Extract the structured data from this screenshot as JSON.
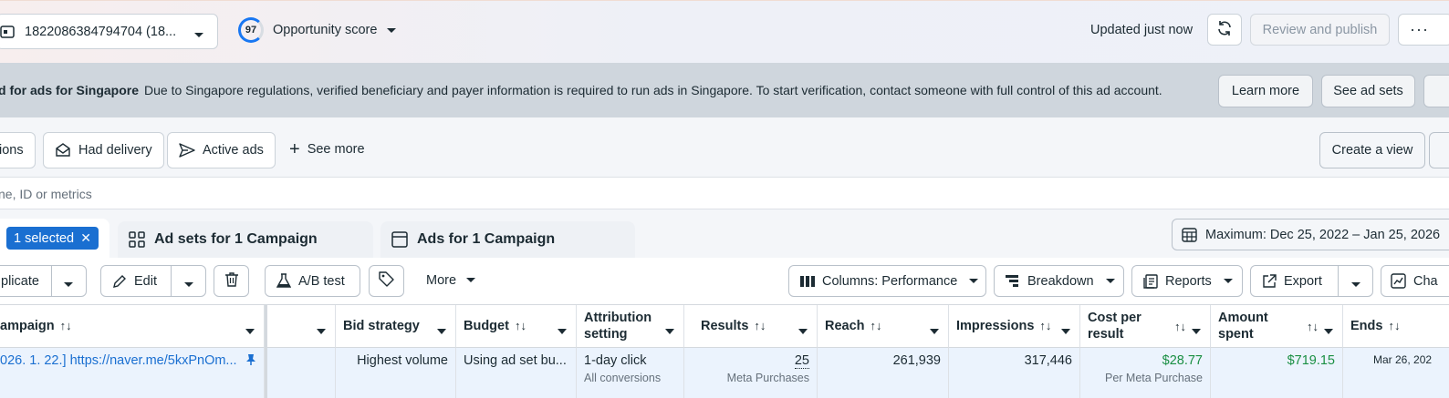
{
  "topbar": {
    "account_label": "1822086384794704 (18...",
    "opportunity_score": "97",
    "opportunity_label": "Opportunity score",
    "updated": "Updated just now",
    "review_publish": "Review and publish",
    "more": "···"
  },
  "banner": {
    "title": "d for ads for Singapore",
    "message": "Due to Singapore regulations, verified beneficiary and payer information is required to run ads in Singapore. To start verification, contact someone with full control of this ad account.",
    "learn_more": "Learn more",
    "see_ad_sets": "See ad sets"
  },
  "filters": {
    "chip_partial": "ions",
    "had_delivery": "Had delivery",
    "active_ads": "Active ads",
    "see_more": "See more",
    "create_view": "Create a view"
  },
  "search": {
    "placeholder": "ne, ID or metrics"
  },
  "tabs": {
    "selected": "1 selected",
    "ad_sets": "Ad sets for 1 Campaign",
    "ads": "Ads for 1 Campaign",
    "date_range": "Maximum: Dec 25, 2022 – Jan 25, 2026"
  },
  "toolbar": {
    "duplicate": "plicate",
    "edit": "Edit",
    "ab_test": "A/B test",
    "more": "More",
    "columns": "Columns: Performance",
    "breakdown": "Breakdown",
    "reports": "Reports",
    "export": "Export",
    "chart": "Cha"
  },
  "table": {
    "headers": {
      "campaign": "ampaign",
      "bid_strategy": "Bid strategy",
      "budget": "Budget",
      "attribution_l1": "Attribution",
      "attribution_l2": "setting",
      "results": "Results",
      "reach": "Reach",
      "impressions": "Impressions",
      "cpr_l1": "Cost per",
      "cpr_l2": "result",
      "spent_l1": "Amount",
      "spent_l2": "spent",
      "ends": "Ends"
    },
    "row": {
      "campaign": "026. 1. 22.] https://naver.me/5kxPnOm...",
      "bid_strategy": "Highest volume",
      "budget": "Using ad set bu...",
      "attribution": "1-day click",
      "attribution_sub": "All conversions",
      "results": "25",
      "results_sub": "Meta Purchases",
      "reach": "261,939",
      "impressions": "317,446",
      "cpr": "$28.77",
      "cpr_sub": "Per Meta Purchase",
      "spent": "$719.15",
      "ends": "Mar 26, 202"
    }
  },
  "colors": {
    "accent": "#1a6fd1",
    "green": "#1a8f43",
    "banner_bg": "#cfd6dd"
  }
}
